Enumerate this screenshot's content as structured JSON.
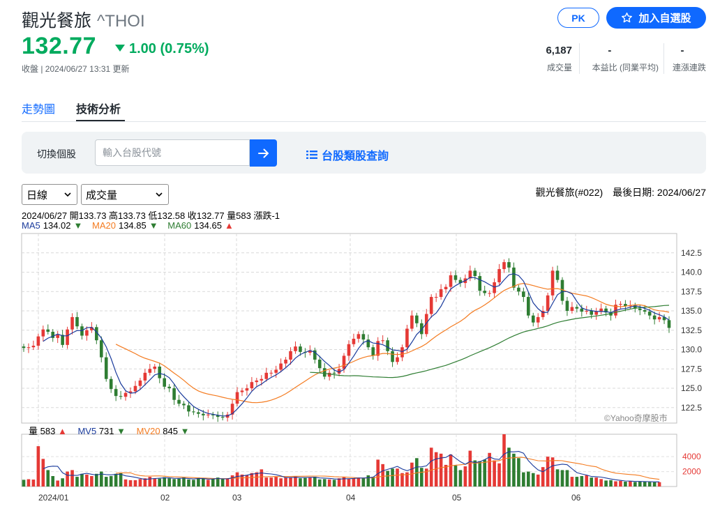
{
  "header": {
    "name": "觀光餐旅",
    "symbol": "^THOI",
    "price": "132.77",
    "change": "1.00 (0.75%)",
    "status": "收盤 | 2024/06/27 13:31 更新",
    "pk_label": "PK",
    "watch_label": "加入自選股",
    "stats": [
      {
        "value": "6,187",
        "label": "成交量"
      },
      {
        "value": "-",
        "label": "本益比 (同業平均)"
      },
      {
        "value": "-",
        "label": "連漲連跌"
      }
    ]
  },
  "tabs": [
    {
      "label": "走勢圖"
    },
    {
      "label": "技術分析"
    }
  ],
  "switcher": {
    "label": "切換個股",
    "placeholder": "輸入台股代號",
    "category_link": "台股類股查詢"
  },
  "controls": {
    "period": "日線",
    "indicator": "成交量",
    "stock_info": "觀光餐旅(#022)　最後日期: 2024/06/27",
    "ohlc": "2024/06/27 開133.73 高133.73 低132.58 收132.77 量583 漲跌-1",
    "ma": [
      {
        "label": "MA5",
        "value": "134.02",
        "dir": "▼"
      },
      {
        "label": "MA20",
        "value": "134.85",
        "dir": "▼"
      },
      {
        "label": "MA60",
        "value": "134.65",
        "dir": "▲"
      }
    ],
    "vol": [
      {
        "label": "量",
        "value": "583",
        "dir": "▲"
      },
      {
        "label": "MV5",
        "value": "731",
        "dir": "▼"
      },
      {
        "label": "MV20",
        "value": "845",
        "dir": "▼"
      }
    ]
  },
  "colors": {
    "up": "#e53935",
    "down": "#2e7d32",
    "ma5": "#1a3b9c",
    "ma20": "#f47b20",
    "ma60": "#2e7d32",
    "accent": "#0f69ff",
    "price_down": "#00ab5e"
  },
  "chart_data": {
    "type": "candlestick",
    "title": "",
    "watermark": "©Yahoo奇摩股市",
    "price_axis": {
      "range": [
        120.5,
        145.0
      ],
      "ticks": [
        "122.5",
        "125.0",
        "127.5",
        "130.0",
        "132.5",
        "135.0",
        "137.5",
        "140.0",
        "142.5"
      ]
    },
    "volume_axis": {
      "range": [
        0,
        7000
      ],
      "ticks": [
        "2000",
        "4000"
      ]
    },
    "x_labels": [
      "2024/01",
      "02",
      "03",
      "04",
      "05",
      "06"
    ],
    "closes": [
      130.2,
      130.3,
      130.5,
      131.7,
      132.6,
      132.3,
      131.5,
      131.9,
      130.6,
      132.6,
      134.2,
      133.0,
      131.8,
      132.5,
      132.9,
      131.2,
      129.0,
      126.2,
      124.9,
      124.0,
      123.9,
      124.4,
      124.6,
      125.3,
      126.0,
      127.0,
      127.5,
      127.8,
      126.3,
      125.2,
      125.0,
      123.5,
      123.0,
      122.8,
      122.0,
      121.9,
      121.7,
      121.5,
      121.6,
      121.5,
      121.3,
      121.2,
      121.6,
      123.0,
      124.5,
      124.7,
      125.0,
      125.8,
      126.0,
      126.2,
      127.0,
      127.0,
      127.4,
      128.2,
      128.7,
      129.8,
      130.4,
      129.7,
      129.6,
      129.9,
      128.7,
      127.6,
      126.5,
      127.0,
      126.9,
      127.5,
      129.2,
      130.7,
      131.4,
      132.0,
      131.3,
      130.3,
      129.2,
      131.1,
      131.2,
      129.8,
      128.4,
      129.0,
      130.3,
      132.7,
      134.4,
      133.4,
      132.0,
      134.6,
      136.8,
      136.8,
      137.8,
      138.1,
      139.6,
      139.0,
      138.6,
      139.2,
      140.2,
      139.5,
      137.6,
      137.3,
      137.3,
      138.7,
      140.4,
      141.3,
      140.6,
      138.0,
      137.5,
      136.8,
      134.4,
      133.5,
      134.2,
      135.0,
      137.0,
      140.2,
      139.0,
      136.3,
      135.0,
      135.5,
      135.3,
      134.9,
      135.0,
      134.5,
      134.9,
      135.3,
      134.8,
      134.4,
      135.8,
      135.9,
      135.6,
      135.7,
      135.3,
      135.1,
      134.9,
      134.4,
      133.9,
      134.2,
      133.8,
      132.8
    ],
    "volumes": [
      900,
      980,
      930,
      5400,
      3700,
      2200,
      1400,
      800,
      1100,
      2000,
      2200,
      1300,
      1700,
      1600,
      1400,
      1700,
      2000,
      1300,
      1400,
      1700,
      1800,
      950,
      850,
      850,
      1000,
      1100,
      1300,
      1100,
      1050,
      1250,
      1100,
      1000,
      1050,
      1200,
      950,
      900,
      1200,
      1050,
      900,
      1000,
      1200,
      1000,
      1100,
      1500,
      1900,
      1600,
      1500,
      1800,
      1900,
      2300,
      1200,
      1200,
      1300,
      1100,
      1200,
      1200,
      1400,
      1100,
      1150,
      1250,
      1300,
      950,
      1000,
      950,
      900,
      1100,
      1300,
      1000,
      1100,
      1200,
      1100,
      1500,
      1300,
      3600,
      3000,
      2100,
      2400,
      2400,
      1800,
      1900,
      3200,
      3800,
      2500,
      2400,
      5200,
      4600,
      4400,
      2900,
      4300,
      2800,
      2200,
      2700,
      4800,
      3500,
      3400,
      3600,
      4500,
      3500,
      3100,
      7000,
      5200,
      4400,
      3800,
      1900,
      2000,
      1800,
      1600,
      2600,
      4000,
      3900,
      2300,
      2200,
      2200,
      1300,
      1300,
      1400,
      1500,
      1200,
      1200,
      1000,
      800,
      850,
      700,
      750,
      650,
      700,
      600,
      700,
      650,
      600,
      580,
      583
    ]
  }
}
